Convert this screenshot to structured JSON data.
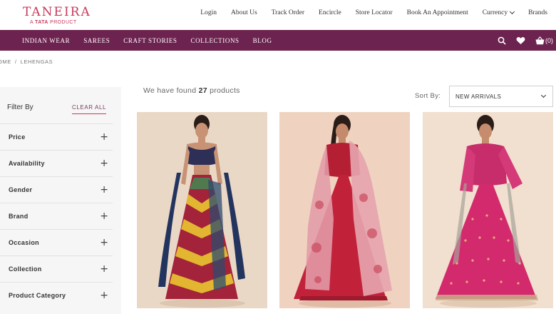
{
  "brand": {
    "name": "TANEIRA",
    "tagline_prefix": "A",
    "tagline_brand": "TATA",
    "tagline_suffix": "PRODUCT"
  },
  "top_links": [
    "Login",
    "About Us",
    "Track Order",
    "Encircle",
    "Store Locator",
    "Book An Appointment",
    "Currency",
    "Brands"
  ],
  "nav": {
    "items": [
      "INDIAN WEAR",
      "SAREES",
      "CRAFT STORIES",
      "COLLECTIONS",
      "BLOG"
    ],
    "cart_count": "(0)"
  },
  "breadcrumb": {
    "home": "OME",
    "separator": "/",
    "current": "LEHENGAS"
  },
  "sidebar": {
    "title": "Filter By",
    "clear_all": "CLEAR ALL",
    "filters": [
      "Price",
      "Availability",
      "Gender",
      "Brand",
      "Occasion",
      "Collection",
      "Product Category"
    ]
  },
  "results": {
    "prefix": "We have found",
    "count": "27",
    "suffix": "products"
  },
  "sort": {
    "label": "Sort By:",
    "value": "NEW ARRIVALS"
  },
  "products": [
    {
      "image": "navy-multicolor-striped-lehenga",
      "bg": "#ead8c6"
    },
    {
      "image": "red-lehenga-floral-dupatta",
      "bg": "#efd2bf"
    },
    {
      "image": "pink-embroidered-lehenga",
      "bg": "#f1dfcf"
    }
  ],
  "colors": {
    "brand": "#c8385a",
    "nav_bg": "#6d2350",
    "sidebar_bg": "#f6f6f6"
  }
}
